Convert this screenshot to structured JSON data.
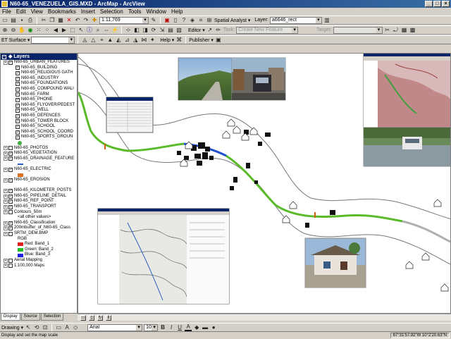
{
  "window": {
    "title": "N60-65_VENEZUELA_GIS.MXD - ArcMap - ArcView",
    "min": "_",
    "max": "□",
    "close": "×"
  },
  "menu": [
    "File",
    "Edit",
    "View",
    "Bookmarks",
    "Insert",
    "Selection",
    "Tools",
    "Window",
    "Help"
  ],
  "toolbar1": {
    "scale": "1:11,769",
    "spatial_analyst": "Spatial Analyst ▾",
    "layer_label": "Layer:",
    "layer_value": "a6646_rect"
  },
  "toolbar2": {
    "editor": "Editor ▾",
    "task_label": "Task:",
    "task_value": "Create New Feature",
    "target_label": "Target:"
  },
  "toolbar3": {
    "et_surface": "ET Surface ▾",
    "help": "Help ▾",
    "publisher": "Publisher ▾"
  },
  "toc": {
    "header": "Layers",
    "items": [
      {
        "label": "N60-65_URBAN_FEATURES",
        "checked": true,
        "ind": 1
      },
      {
        "label": "N60-65_BUILDING",
        "checked": true,
        "ind": 2
      },
      {
        "label": "N60-65_RELIGIOUS GATH",
        "checked": true,
        "ind": 2
      },
      {
        "label": "N60-65_INDUSTRY",
        "checked": true,
        "ind": 2
      },
      {
        "label": "N60-65_FOUNDATIONS",
        "checked": true,
        "ind": 2
      },
      {
        "label": "N60-65_COMPOUND WALI",
        "checked": true,
        "ind": 2
      },
      {
        "label": "N60-65_FARM",
        "checked": true,
        "ind": 2
      },
      {
        "label": "N60-65_PHONE",
        "checked": true,
        "ind": 2
      },
      {
        "label": "N60-65_FLYOVER/PEDEST",
        "checked": true,
        "ind": 2
      },
      {
        "label": "N60-65_WELL",
        "checked": true,
        "ind": 2
      },
      {
        "label": "N60-65_DEFENCES",
        "checked": true,
        "ind": 2
      },
      {
        "label": "N60-65_TOWER BLOCK",
        "checked": true,
        "ind": 2
      },
      {
        "label": "N60-65_SCHOOL",
        "checked": true,
        "ind": 2
      },
      {
        "label": "N60-65_SCHOOL_COORD",
        "checked": true,
        "ind": 2
      },
      {
        "label": "N60-65_SPORTS_GROUN",
        "checked": true,
        "ind": 2
      },
      {
        "label": "",
        "checked": null,
        "ind": 3,
        "sym": "circle-green"
      },
      {
        "label": "N60-65_PHOTOS",
        "checked": false,
        "ind": 1
      },
      {
        "label": "N60-65_VEGETATION",
        "checked": true,
        "ind": 1
      },
      {
        "label": "N60-65_DRAINAGE_FEATURE",
        "checked": true,
        "ind": 1
      },
      {
        "label": "",
        "checked": null,
        "ind": 3,
        "sym": "line-blue"
      },
      {
        "label": "N60-65_ELECTRIC",
        "checked": true,
        "ind": 1
      },
      {
        "label": "",
        "checked": null,
        "ind": 3,
        "sym": "square-orange"
      },
      {
        "label": "N60-65_EROSION",
        "checked": true,
        "ind": 1
      },
      {
        "label": "",
        "checked": null,
        "ind": 3,
        "sym": "blank"
      },
      {
        "label": "N60-65_KILOMETER_POSTS",
        "checked": true,
        "ind": 1
      },
      {
        "label": "N60-65_PIPELINE_DETAIL",
        "checked": true,
        "ind": 1
      },
      {
        "label": "N60-65_REF_POINT",
        "checked": true,
        "ind": 1
      },
      {
        "label": "N60-65_TRANSPORT",
        "checked": true,
        "ind": 1
      },
      {
        "label": "Contours_50m",
        "checked": false,
        "ind": 1
      },
      {
        "label": "<all other values>",
        "checked": null,
        "ind": 3
      },
      {
        "label": "N60-65_Classification",
        "checked": true,
        "ind": 1
      },
      {
        "label": "200mbuffer_of_N60-65_Class",
        "checked": true,
        "ind": 1
      },
      {
        "label": "SRTM_DEM.BMP",
        "checked": false,
        "ind": 1
      },
      {
        "label": "RGB",
        "checked": null,
        "ind": 3
      },
      {
        "label": "Red:   Band_1",
        "checked": null,
        "ind": 3,
        "sym": "sq-red"
      },
      {
        "label": "Green: Band_2",
        "checked": null,
        "ind": 3,
        "sym": "sq-green"
      },
      {
        "label": "Blue:  Band_3",
        "checked": null,
        "ind": 3,
        "sym": "sq-blue"
      },
      {
        "label": "Aerial Mapping",
        "checked": false,
        "ind": 1
      },
      {
        "label": "1:100,000 Maps",
        "checked": false,
        "ind": 1
      }
    ],
    "tabs": [
      "Display",
      "Source",
      "Selection"
    ]
  },
  "draw": {
    "drawing": "Drawing ▾",
    "font": "Arial",
    "size": "10",
    "bold": "B",
    "italic": "I",
    "underline": "U"
  },
  "status": {
    "message": "Display and set the map scale",
    "coords": "67°31'57.92\"W  10°2'20.63\"N"
  },
  "colors": {
    "pipeline": "#5aba2a",
    "pipeline_sel": "#2050d0",
    "buffer": "#777777",
    "title_bg": "#0a246a"
  }
}
